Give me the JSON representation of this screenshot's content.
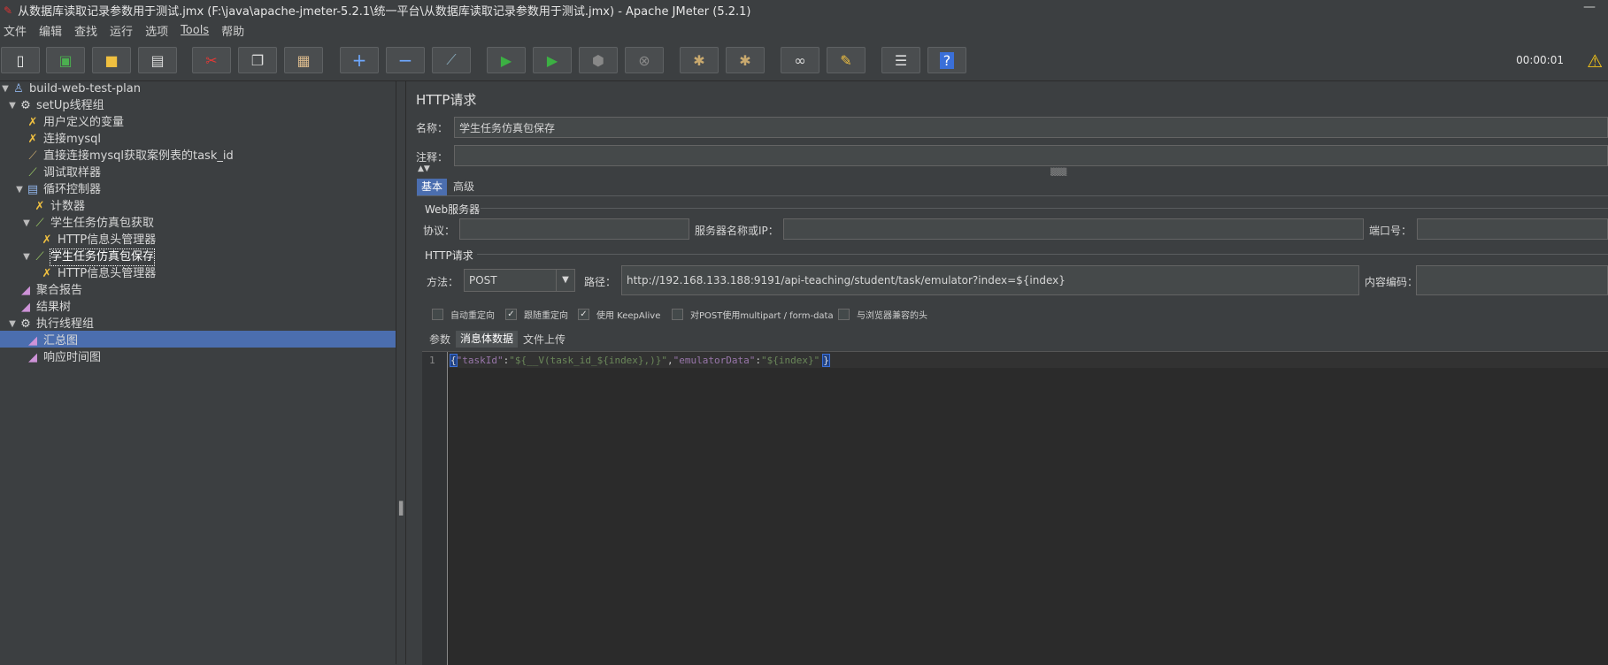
{
  "window": {
    "title": "从数据库读取记录参数用于测试.jmx (F:\\java\\apache-jmeter-5.2.1\\统一平台\\从数据库读取记录参数用于测试.jmx) - Apache JMeter (5.2.1)",
    "minimize_glyph": "—"
  },
  "menu": [
    "文件",
    "编辑",
    "查找",
    "运行",
    "选项",
    "Tools",
    "帮助"
  ],
  "toolbar": {
    "timer": "00:00:01"
  },
  "tree": {
    "items": [
      {
        "label": "build-web-test-plan"
      },
      {
        "label": "setUp线程组"
      },
      {
        "label": "用户定义的变量"
      },
      {
        "label": "连接mysql"
      },
      {
        "label": "直接连接mysql获取案例表的task_id"
      },
      {
        "label": "调试取样器"
      },
      {
        "label": "循环控制器"
      },
      {
        "label": "计数器"
      },
      {
        "label": "学生任务仿真包获取"
      },
      {
        "label": "HTTP信息头管理器"
      },
      {
        "label": "学生任务仿真包保存"
      },
      {
        "label": "HTTP信息头管理器"
      },
      {
        "label": "聚合报告"
      },
      {
        "label": "结果树"
      },
      {
        "label": "执行线程组"
      },
      {
        "label": "汇总图"
      },
      {
        "label": "响应时间图"
      }
    ]
  },
  "panel": {
    "title": "HTTP请求",
    "name_label": "名称：",
    "name_value": "学生任务仿真包保存",
    "comment_label": "注释：",
    "comment_value": "",
    "tabs": [
      "基本",
      "高级"
    ],
    "web_server": {
      "group_title": "Web服务器",
      "protocol_label": "协议：",
      "protocol_value": "",
      "server_label": "服务器名称或IP：",
      "server_value": "",
      "port_label": "端口号：",
      "port_value": ""
    },
    "http_request": {
      "group_title": "HTTP请求",
      "method_label": "方法：",
      "method_value": "POST",
      "path_label": "路径：",
      "path_value": "http://192.168.133.188:9191/api-teaching/student/task/emulator?index=${index}",
      "encoding_label": "内容编码：",
      "encoding_value": ""
    },
    "checkboxes": [
      {
        "label": "自动重定向",
        "checked": false
      },
      {
        "label": "跟随重定向",
        "checked": true
      },
      {
        "label": "使用 KeepAlive",
        "checked": true
      },
      {
        "label": "对POST使用multipart / form-data",
        "checked": false
      },
      {
        "label": "与浏览器兼容的头",
        "checked": false
      }
    ],
    "body_tabs": [
      "参数",
      "消息体数据",
      "文件上传"
    ],
    "body": {
      "line_number": "1",
      "open_brace": "{",
      "key1": "\"taskId\"",
      "colon1": ":",
      "val1": "\"${__V(task_id_${index},)}\"",
      "comma": ",",
      "key2": "\"emulatorData\"",
      "colon2": ":",
      "val2": "\"${index}\"",
      "close_brace": "}"
    }
  },
  "colors": {
    "background": "#3c3f41",
    "selection": "#4b6eaf",
    "editor_bg": "#2b2b2b",
    "json_key": "#9876aa",
    "json_string": "#6a8759"
  }
}
